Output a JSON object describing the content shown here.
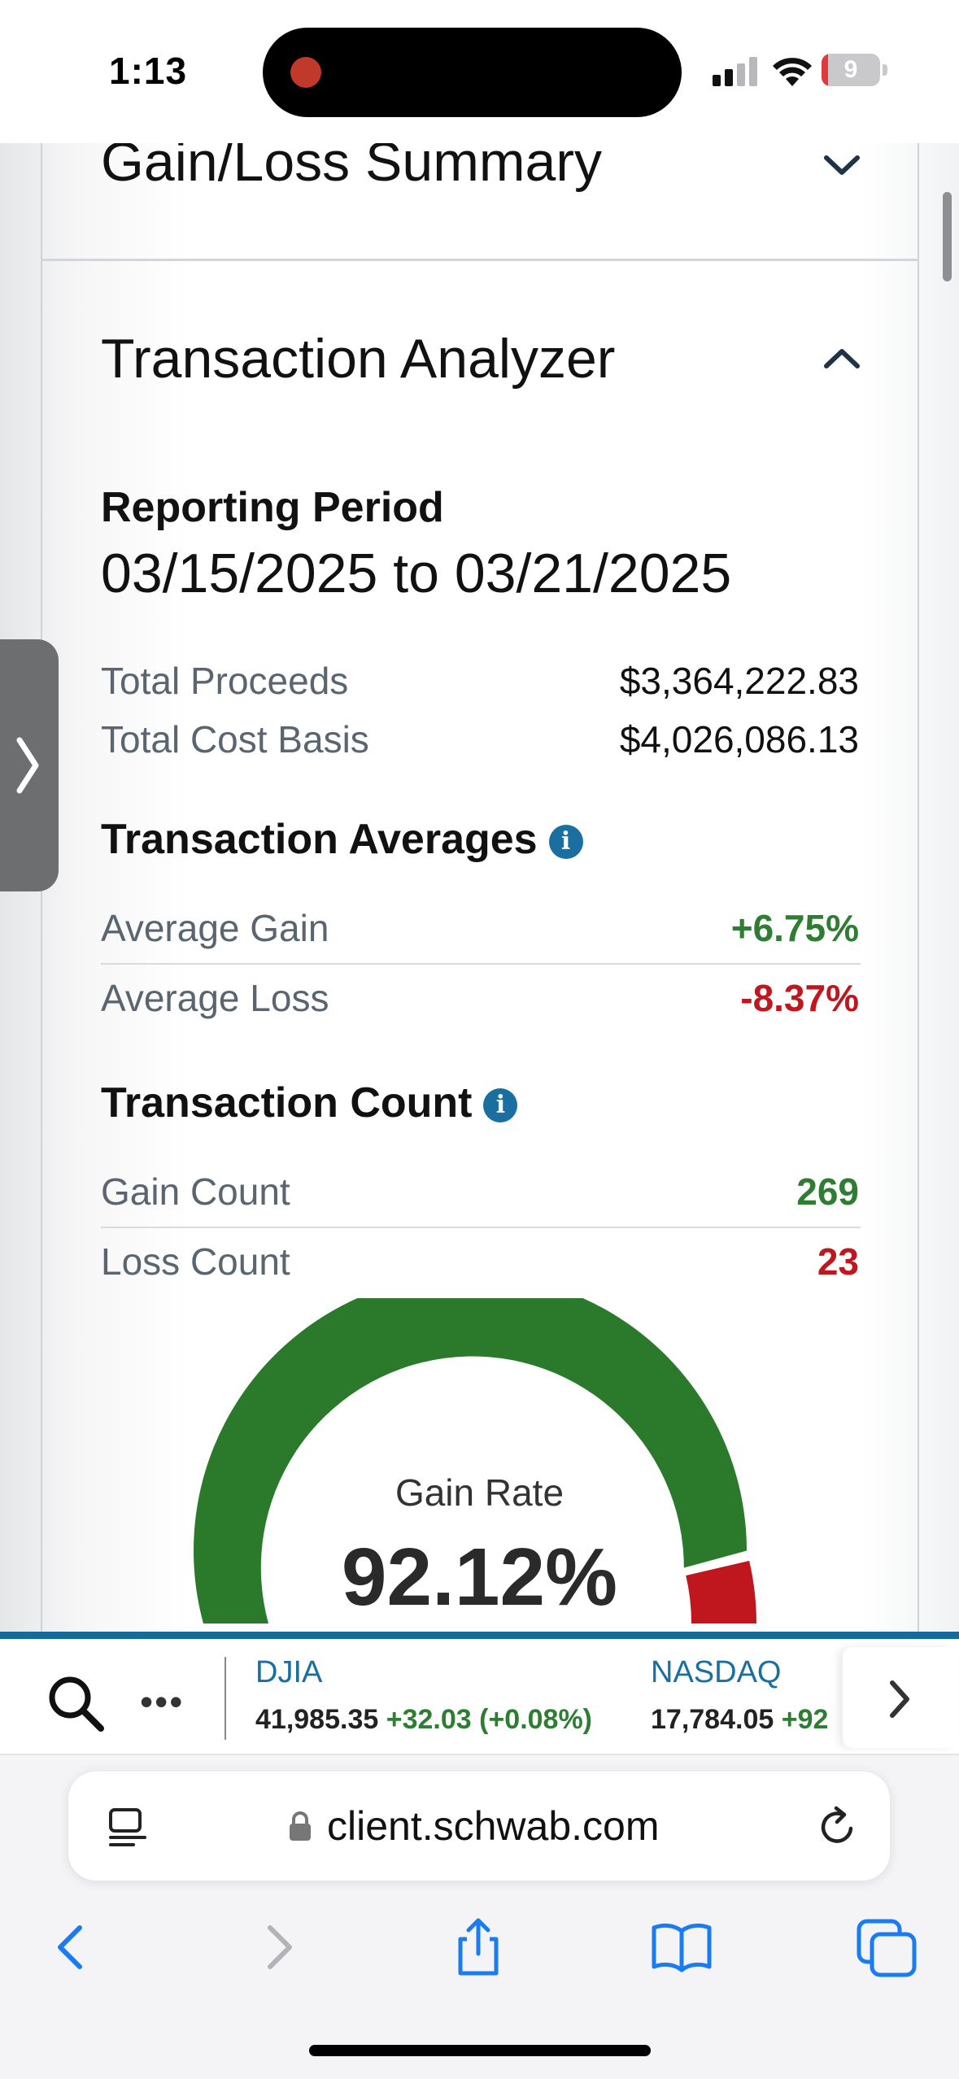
{
  "status_bar": {
    "time": "1:13",
    "battery_level": "9",
    "battery_fraction": 0.09
  },
  "sections": {
    "gain_loss_title": "Gain/Loss Summary",
    "analyzer_title": "Transaction Analyzer"
  },
  "reporting": {
    "label": "Reporting Period",
    "range": "03/15/2025 to 03/21/2025"
  },
  "totals": {
    "proceeds_label": "Total Proceeds",
    "proceeds_value": "$3,364,222.83",
    "cost_label": "Total Cost Basis",
    "cost_value": "$4,026,086.13"
  },
  "averages": {
    "title": "Transaction Averages",
    "info_glyph": "i",
    "gain_label": "Average Gain",
    "gain_value": "+6.75%",
    "loss_label": "Average Loss",
    "loss_value": "-8.37%"
  },
  "counts": {
    "title": "Transaction Count",
    "info_glyph": "i",
    "gain_label": "Gain Count",
    "gain_value": "269",
    "loss_label": "Loss Count",
    "loss_value": "23"
  },
  "gauge": {
    "label": "Gain Rate",
    "value": "92.12%",
    "gain_fraction": 0.9212,
    "gain_color": "#2b7a2b",
    "loss_color": "#c0161e"
  },
  "ticker": {
    "more": "•••",
    "items": [
      {
        "name": "DJIA",
        "price": "41,985.35",
        "change": "+32.03 (+0.08%)"
      },
      {
        "name": "NASDAQ",
        "price": "17,784.05",
        "change": "+92"
      }
    ]
  },
  "browser": {
    "url": "client.schwab.com"
  },
  "colors": {
    "accent": "#176b98",
    "positive": "#2e7d32",
    "negative": "#c0161e",
    "ios_blue": "#1a7cf3"
  }
}
